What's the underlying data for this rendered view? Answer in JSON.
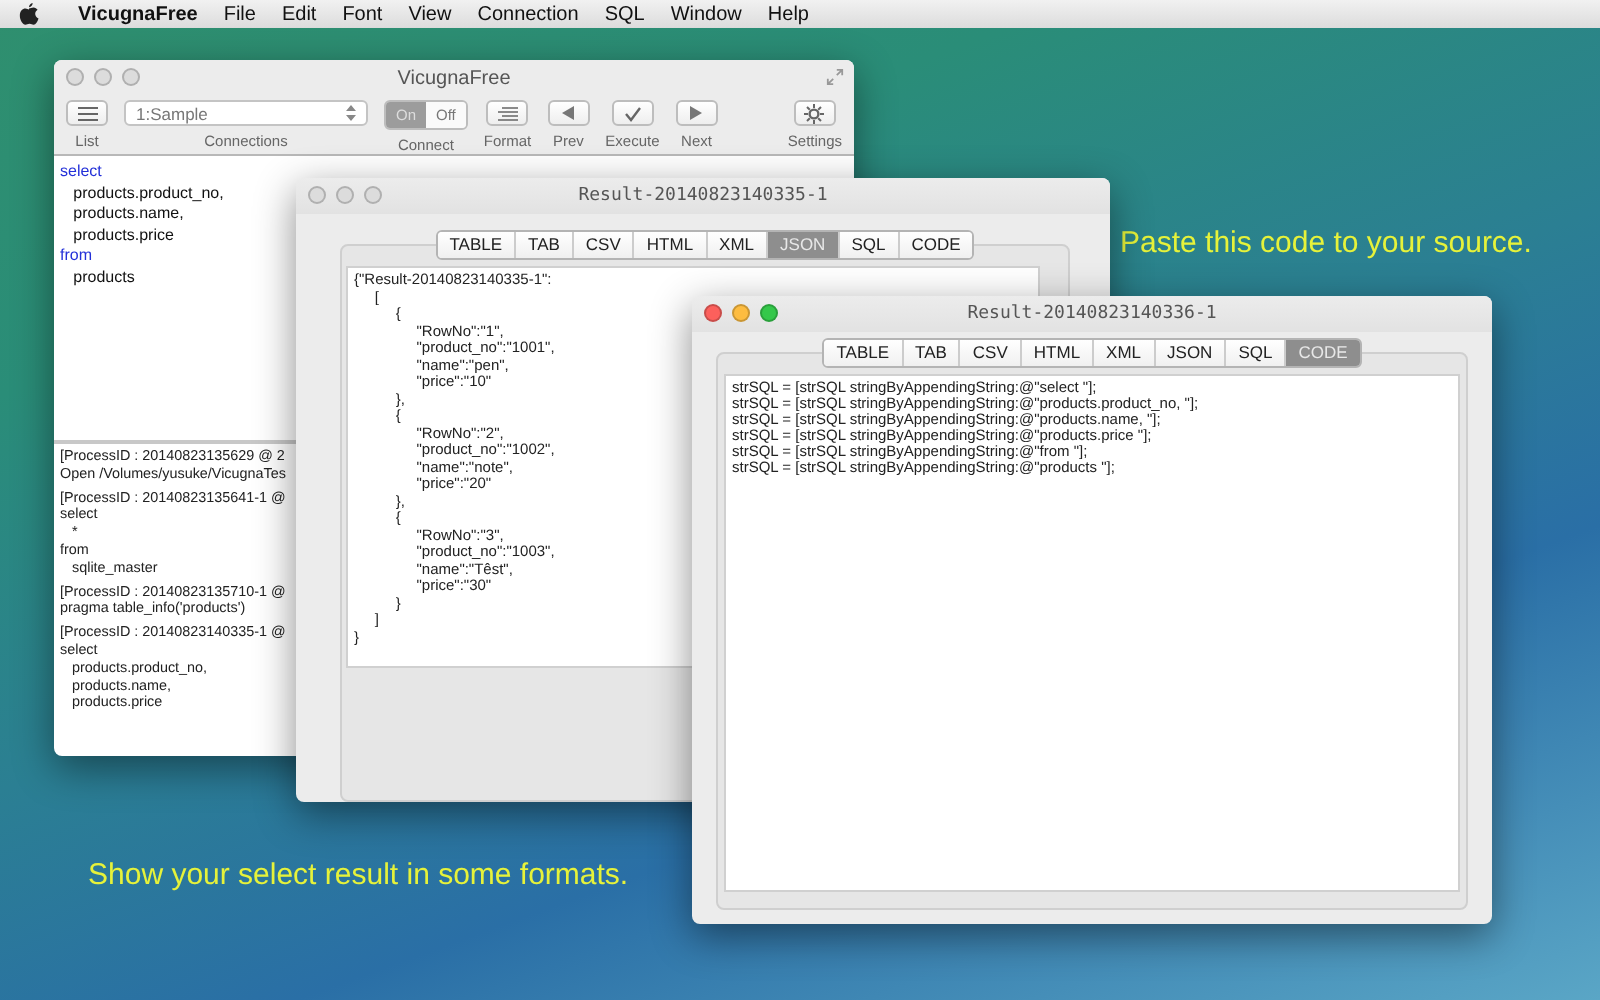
{
  "menu_bar": {
    "app_name": "VicugnaFree",
    "items": [
      "File",
      "Edit",
      "Font",
      "View",
      "Connection",
      "SQL",
      "Window",
      "Help"
    ]
  },
  "main_window": {
    "title": "VicugnaFree",
    "active": false,
    "toolbar": {
      "list_label": "List",
      "connection_value": "1:Sample",
      "connections_label": "Connections",
      "connect_segments": [
        {
          "label": "On",
          "selected": true
        },
        {
          "label": "Off",
          "selected": false
        }
      ],
      "connect_label": "Connect",
      "format_label": "Format",
      "prev_label": "Prev",
      "execute_label": "Execute",
      "next_label": "Next",
      "settings_label": "Settings"
    },
    "editor_lines": [
      {
        "text": "select",
        "kind": "keyword"
      },
      {
        "text": "\tproducts.product_no,",
        "kind": "plain"
      },
      {
        "text": "\tproducts.name,",
        "kind": "plain"
      },
      {
        "text": "\tproducts.price",
        "kind": "plain"
      },
      {
        "text": "from",
        "kind": "keyword"
      },
      {
        "text": "\tproducts",
        "kind": "plain"
      }
    ],
    "log_entries": [
      {
        "lines": [
          "[ProcessID : 20140823135629 @ 2",
          "Open /Volumes/yusuke/VicugnaTes"
        ]
      },
      {
        "lines": [
          "[ProcessID : 20140823135641-1 @",
          "select",
          "\t*",
          "from",
          "\tsqlite_master"
        ]
      },
      {
        "lines": [
          "[ProcessID : 20140823135710-1 @",
          "pragma table_info('products')"
        ]
      },
      {
        "lines": [
          "[ProcessID : 20140823140335-1 @",
          "select",
          "\tproducts.product_no,",
          "\tproducts.name,",
          "\tproducts.price"
        ]
      }
    ]
  },
  "json_window": {
    "title": "Result-20140823140335-1",
    "active": false,
    "tabs": [
      {
        "label": "TABLE",
        "selected": false
      },
      {
        "label": "TAB",
        "selected": false
      },
      {
        "label": "CSV",
        "selected": false
      },
      {
        "label": "HTML",
        "selected": false
      },
      {
        "label": "XML",
        "selected": false
      },
      {
        "label": "JSON",
        "selected": true
      },
      {
        "label": "SQL",
        "selected": false
      },
      {
        "label": "CODE",
        "selected": false
      }
    ],
    "lines": [
      "{\"Result-20140823140335-1\":",
      "\t[",
      "\t\t{",
      "\t\t\t\"RowNo\":\"1\",",
      "\t\t\t\"product_no\":\"1001\",",
      "\t\t\t\"name\":\"pen\",",
      "\t\t\t\"price\":\"10\"",
      "\t\t},",
      "\t\t{",
      "\t\t\t\"RowNo\":\"2\",",
      "\t\t\t\"product_no\":\"1002\",",
      "\t\t\t\"name\":\"note\",",
      "\t\t\t\"price\":\"20\"",
      "\t\t},",
      "\t\t{",
      "\t\t\t\"RowNo\":\"3\",",
      "\t\t\t\"product_no\":\"1003\",",
      "\t\t\t\"name\":\"Têst\",",
      "\t\t\t\"price\":\"30\"",
      "\t\t}",
      "\t]",
      "}"
    ]
  },
  "code_window": {
    "title": "Result-20140823140336-1",
    "active": true,
    "tabs": [
      {
        "label": "TABLE",
        "selected": false
      },
      {
        "label": "TAB",
        "selected": false
      },
      {
        "label": "CSV",
        "selected": false
      },
      {
        "label": "HTML",
        "selected": false
      },
      {
        "label": "XML",
        "selected": false
      },
      {
        "label": "JSON",
        "selected": false
      },
      {
        "label": "SQL",
        "selected": false
      },
      {
        "label": "CODE",
        "selected": true
      }
    ],
    "lines": [
      "strSQL = [strSQL stringByAppendingString:@\"select \"];",
      "strSQL = [strSQL stringByAppendingString:@\"products.product_no, \"];",
      "strSQL = [strSQL stringByAppendingString:@\"products.name, \"];",
      "strSQL = [strSQL stringByAppendingString:@\"products.price \"];",
      "strSQL = [strSQL stringByAppendingString:@\"from \"];",
      "strSQL = [strSQL stringByAppendingString:@\"products \"];"
    ]
  },
  "top_caption": "Paste this code to your source.",
  "bottom_caption": "Show your select result in some formats."
}
